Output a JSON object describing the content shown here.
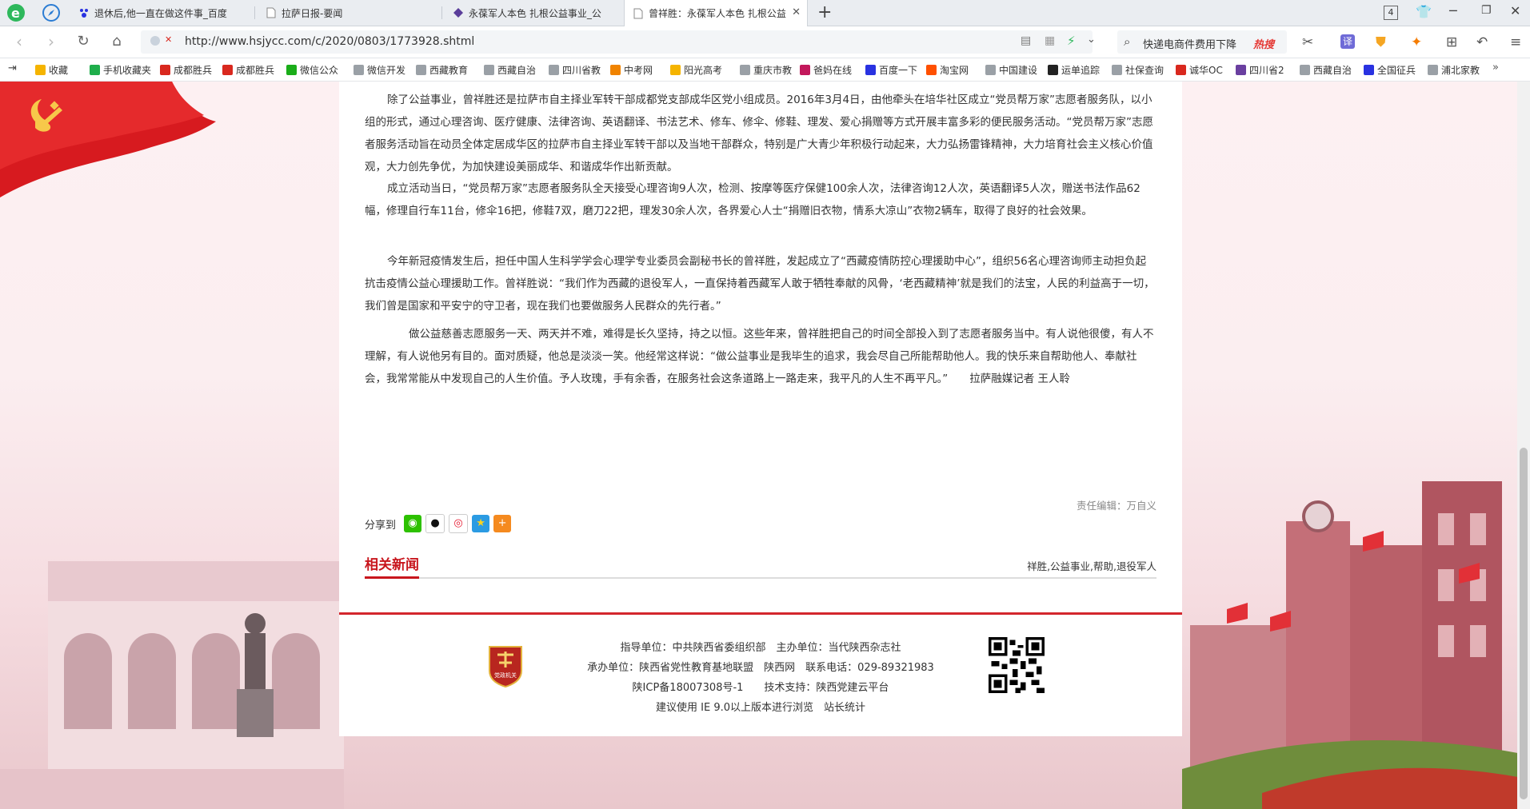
{
  "tabs": [
    {
      "title": "退休后,他一直在做这件事_百度"
    },
    {
      "title": "拉萨日报-要闻"
    },
    {
      "title": "永葆军人本色 扎根公益事业_公"
    },
    {
      "title": "曾祥胜：永葆军人本色 扎根公益"
    }
  ],
  "window_controls": {
    "badge": "4"
  },
  "address": {
    "url": "http://www.hsjycc.com/c/2020/0803/1773928.shtml"
  },
  "search": {
    "text": "快递电商件费用下降",
    "hot": "热搜"
  },
  "bookmarks": [
    {
      "label": "收藏",
      "color": "#f5b400"
    },
    {
      "label": "手机收藏夹",
      "color": "#1fae4b"
    },
    {
      "label": "成都胜兵",
      "color": "#d9281e"
    },
    {
      "label": "成都胜兵",
      "color": "#d9281e"
    },
    {
      "label": "微信公众",
      "color": "#1aad19"
    },
    {
      "label": "微信开发",
      "color": "#9aa0a6"
    },
    {
      "label": "西藏教育",
      "color": "#9aa0a6"
    },
    {
      "label": "西藏自治",
      "color": "#9aa0a6"
    },
    {
      "label": "四川省教",
      "color": "#9aa0a6"
    },
    {
      "label": "中考网",
      "color": "#f08300"
    },
    {
      "label": "阳光高考",
      "color": "#f5b400"
    },
    {
      "label": "重庆市教",
      "color": "#9aa0a6"
    },
    {
      "label": "爸妈在线",
      "color": "#c2185b"
    },
    {
      "label": "百度一下",
      "color": "#2932e1"
    },
    {
      "label": "淘宝网",
      "color": "#ff5000"
    },
    {
      "label": "中国建设",
      "color": "#9aa0a6"
    },
    {
      "label": "运单追踪",
      "color": "#222222"
    },
    {
      "label": "社保查询",
      "color": "#9aa0a6"
    },
    {
      "label": "诚华OC",
      "color": "#d9281e"
    },
    {
      "label": "四川省2",
      "color": "#6a3fa0"
    },
    {
      "label": "西藏自治",
      "color": "#9aa0a6"
    },
    {
      "label": "全国征兵",
      "color": "#2932e1"
    },
    {
      "label": "浦北家教",
      "color": "#9aa0a6"
    }
  ],
  "article": {
    "paragraphs": [
      "除了公益事业，曾祥胜还是拉萨市自主择业军转干部成都党支部成华区党小组成员。2016年3月4日，由他牵头在培华社区成立“党员帮万家”志愿者服务队，以小组的形式，通过心理咨询、医疗健康、法律咨询、英语翻译、书法艺术、修车、修伞、修鞋、理发、爱心捐赠等方式开展丰富多彩的便民服务活动。“党员帮万家”志愿者服务活动旨在动员全体定居成华区的拉萨市自主择业军转干部以及当地干部群众，特别是广大青少年积极行动起来，大力弘扬雷锋精神，大力培育社会主义核心价值观，大力创先争优，为加快建设美丽成华、和谐成华作出新贡献。",
      "成立活动当日，“党员帮万家”志愿者服务队全天接受心理咨询9人次，检测、按摩等医疗保健100余人次，法律咨询12人次，英语翻译5人次，赠送书法作品62幅，修理自行车11台，修伞16把，修鞋7双，磨刀22把，理发30余人次，各界爱心人士“捐赠旧衣物，情系大凉山”衣物2辆车，取得了良好的社会效果。",
      "今年新冠疫情发生后，担任中国人生科学学会心理学专业委员会副秘书长的曾祥胜，发起成立了“西藏疫情防控心理援助中心”，组织56名心理咨询师主动担负起抗击疫情公益心理援助工作。曾祥胜说：“我们作为西藏的退役军人，一直保持着西藏军人敢于牺牲奉献的风骨，‘老西藏精神’就是我们的法宝，人民的利益高于一切，我们曾是国家和平安宁的守卫者，现在我们也要做服务人民群众的先行者。”",
      "　　做公益慈善志愿服务一天、两天并不难，难得是长久坚持，持之以恒。这些年来，曾祥胜把自己的时间全部投入到了志愿者服务当中。有人说他很傻，有人不理解，有人说他另有目的。面对质疑，他总是淡淡一笑。他经常这样说：“做公益事业是我毕生的追求，我会尽自己所能帮助他人。我的快乐来自帮助他人、奉献社会，我常常能从中发现自己的人生价值。予人玫瑰，手有余香，在服务社会这条道路上一路走来，我平凡的人生不再平凡。”　　拉萨融媒记者 王人聆"
    ],
    "editor": "责任编辑：万自义",
    "share_label": "分享到",
    "related_title": "相关新闻",
    "tags": "祥胜,公益事业,帮助,退役军人"
  },
  "footer": {
    "line1": "指导单位：中共陕西省委组织部　主办单位：当代陕西杂志社",
    "line2": "承办单位：陕西省党性教育基地联盟　陕西网　联系电话：029-89321983",
    "line3": "陕ICP备18007308号-1　　技术支持：陕西党建云平台",
    "line4": "建议使用 IE 9.0以上版本进行浏览　站长统计",
    "logo_text": "党政机关"
  },
  "colors": {
    "accent": "#c8161d",
    "tabbar": "#eaedf1"
  }
}
